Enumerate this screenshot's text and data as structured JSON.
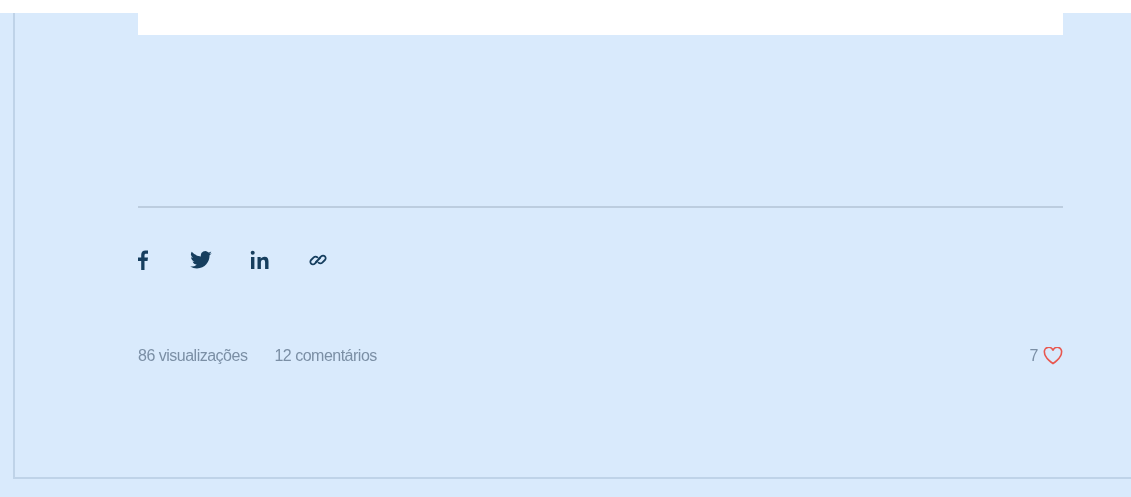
{
  "share_links": [
    {
      "kind": "facebook"
    },
    {
      "kind": "twitter"
    },
    {
      "kind": "linkedin"
    },
    {
      "kind": "link"
    }
  ],
  "stats": {
    "views": "86 visualizações",
    "comments": "12 comentários",
    "likes": "7"
  }
}
